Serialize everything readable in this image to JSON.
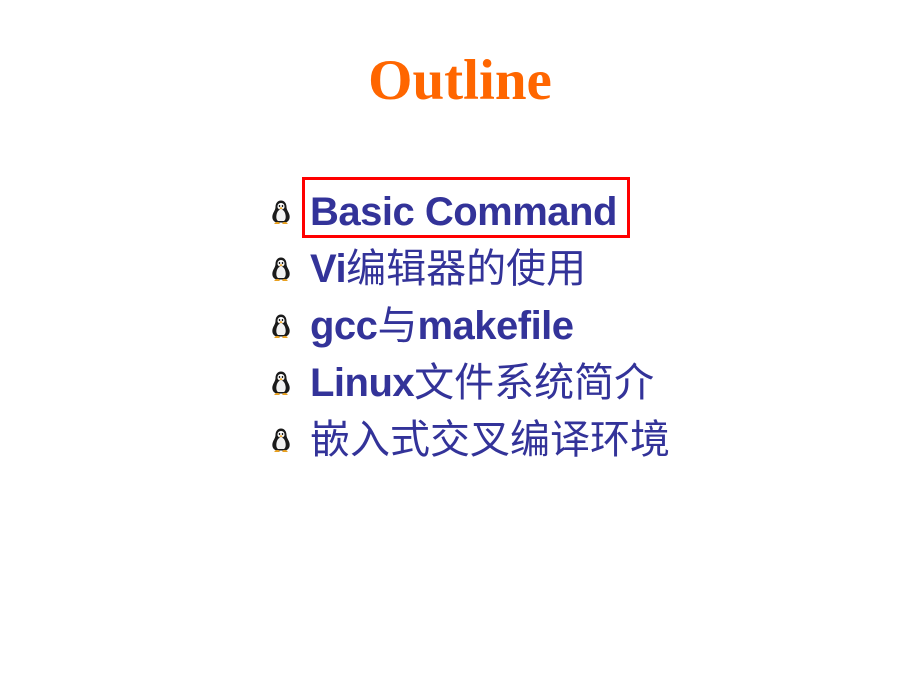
{
  "slide": {
    "title": "Outline",
    "title_color": "#ff6600",
    "background_color": "#ffffff",
    "text_color": "#333399",
    "highlight_color": "#ff0000",
    "bullet_icon": "linux-penguin-icon"
  },
  "outline": {
    "items": [
      {
        "id": "basic-command",
        "latin_prefix": "Basic Command",
        "cjk_middle": "",
        "latin_suffix": "",
        "full_text": "Basic Command",
        "highlighted": true
      },
      {
        "id": "vi-editor",
        "latin_prefix": "Vi",
        "cjk_middle": "编辑器的使用",
        "latin_suffix": "",
        "full_text": "Vi编辑器的使用",
        "highlighted": false
      },
      {
        "id": "gcc-makefile",
        "latin_prefix": "gcc",
        "cjk_middle": "与",
        "latin_suffix": "makefile",
        "full_text": "gcc与makefile",
        "highlighted": false
      },
      {
        "id": "linux-filesystem",
        "latin_prefix": "Linux",
        "cjk_middle": "文件系统简介",
        "latin_suffix": "",
        "full_text": "Linux文件系统简介",
        "highlighted": false
      },
      {
        "id": "embedded-cross-compile",
        "latin_prefix": "",
        "cjk_middle": "嵌入式交叉编译环境",
        "latin_suffix": "",
        "full_text": "嵌入式交叉编译环境",
        "highlighted": false
      }
    ]
  }
}
